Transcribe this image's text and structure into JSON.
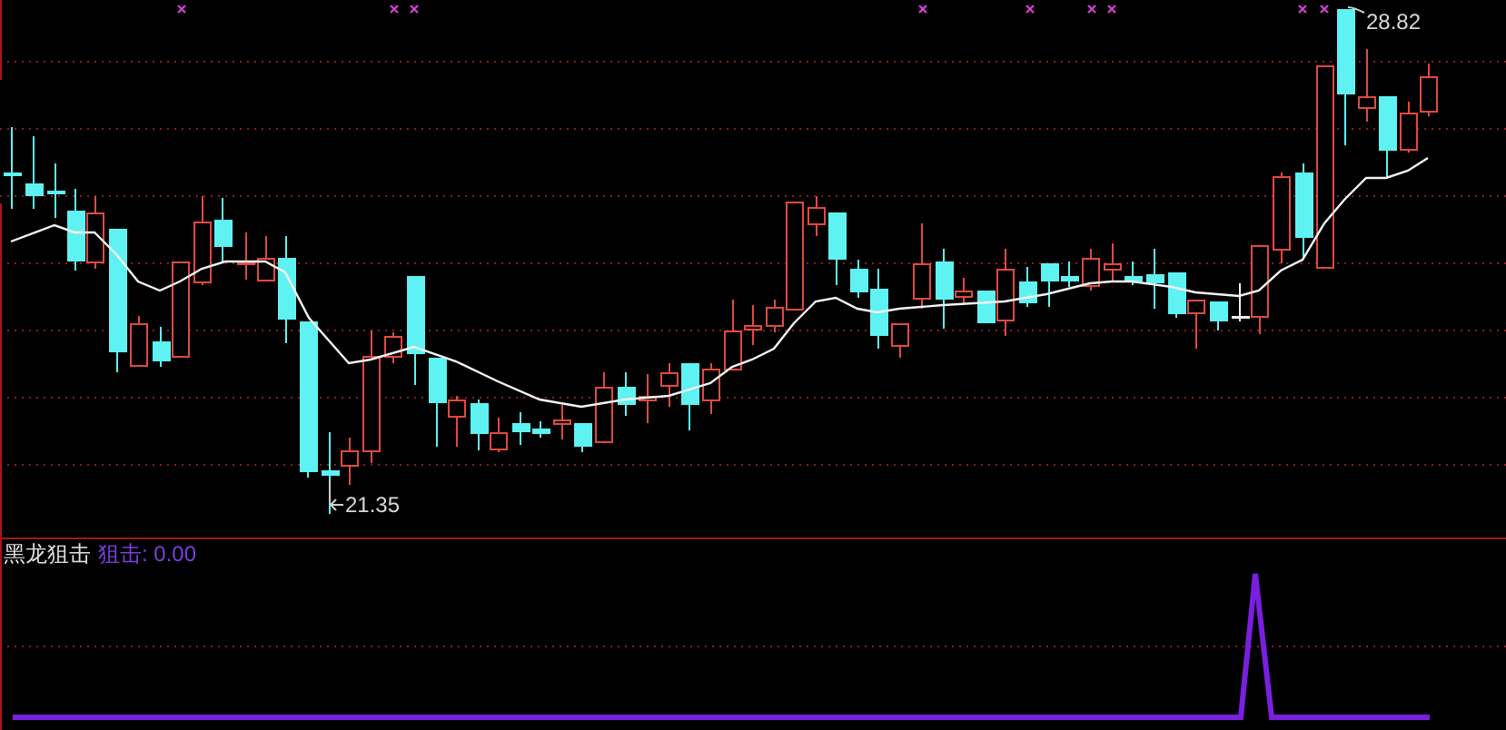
{
  "main_chart": {
    "price_labels": [
      {
        "kind": "low",
        "text": "21.35"
      },
      {
        "kind": "high",
        "text": "28.82"
      }
    ]
  },
  "indicator_panel": {
    "name": "黑龙狙击",
    "reading": "狙击: 0.00"
  }
}
